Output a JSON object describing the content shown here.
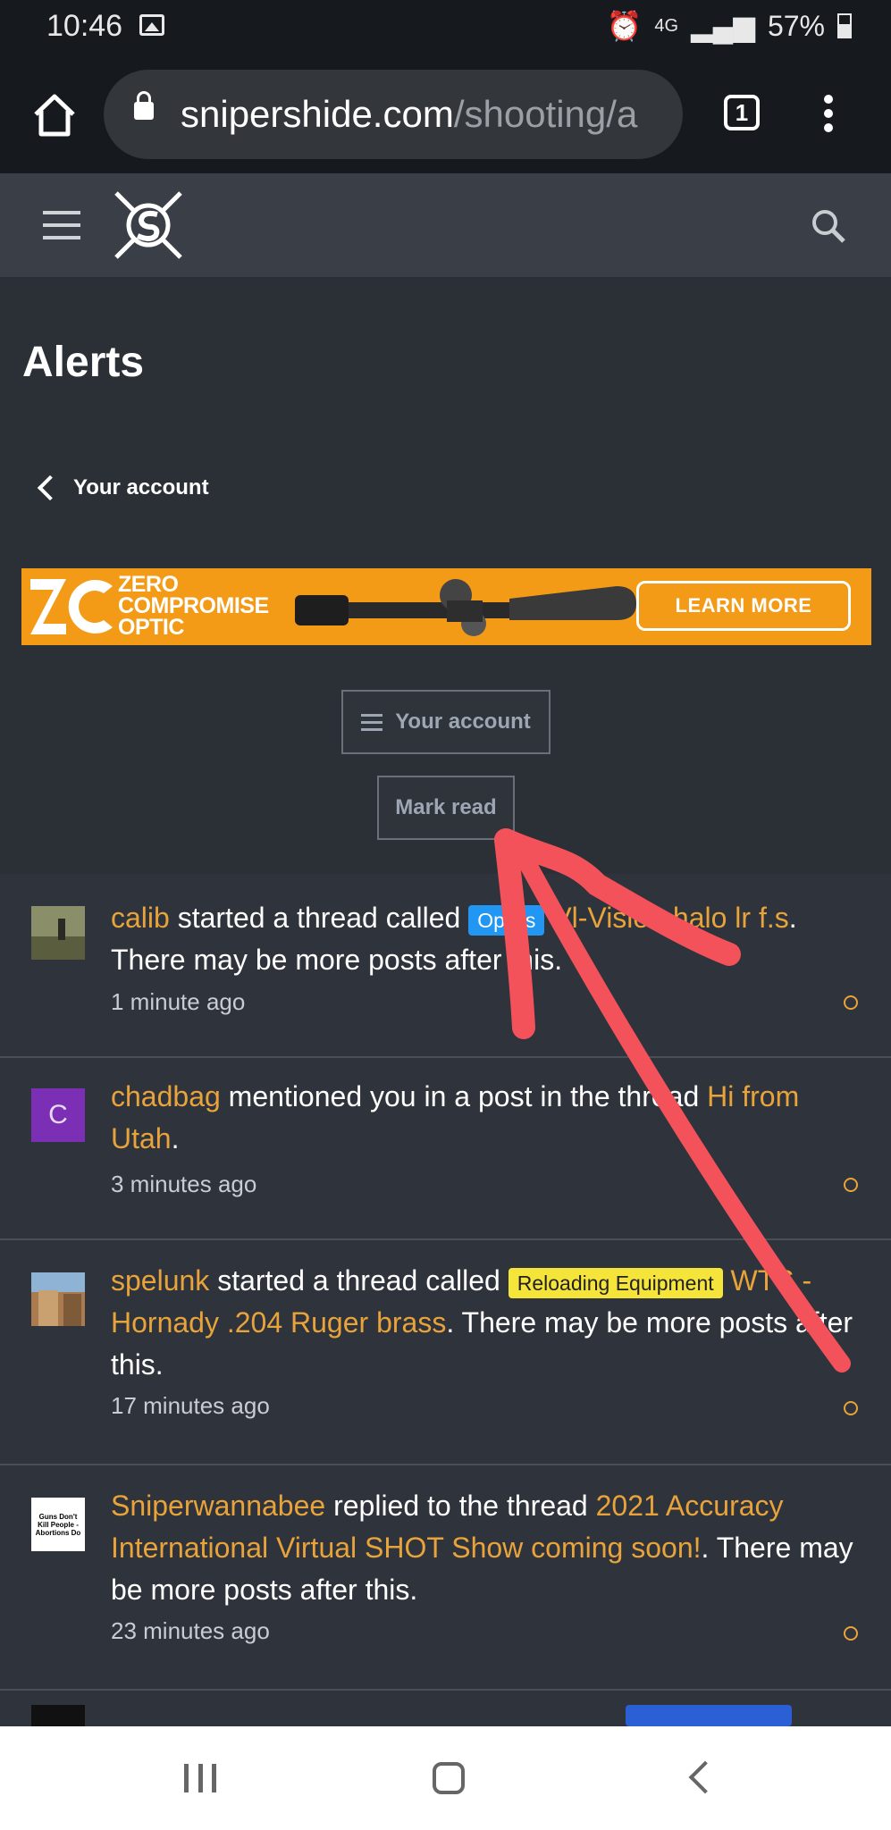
{
  "status_bar": {
    "time": "10:46",
    "network": "4G",
    "battery": "57%"
  },
  "browser": {
    "url_domain": "snipershide.com",
    "url_path": "/shooting/a",
    "tab_count": "1"
  },
  "page": {
    "title": "Alerts",
    "breadcrumb": "Your account",
    "ad": {
      "brand_line1": "ZERO",
      "brand_line2": "COMPROMISE",
      "brand_line3": "OPTIC",
      "cta": "LEARN MORE",
      "color": "#f39a16"
    },
    "account_button": "Your account",
    "mark_read_button": "Mark read"
  },
  "alerts": [
    {
      "user": "calib",
      "action": " started a thread called ",
      "tag": "Optics",
      "thread": "Vl-Vision halo lr f.s",
      "suffix": ". There may be more posts after this.",
      "time": "1 minute ago"
    },
    {
      "avatar_letter": "C",
      "user": "chadbag",
      "action": " mentioned you in a post in the thread ",
      "thread": "Hi from Utah",
      "suffix": ".",
      "time": "3 minutes ago"
    },
    {
      "user": "spelunk",
      "action": " started a thread called ",
      "tag": "Reloading Equipment",
      "thread": "WTS - Hornady .204 Ruger brass",
      "suffix": ". There may be more posts after this.",
      "time": "17 minutes ago"
    },
    {
      "avatar_text": "Guns Don't Kill People - Abortions Do",
      "user": "Sniperwannabee",
      "action": " replied to the thread ",
      "thread": "2021 Accuracy International Virtual SHOT Show coming soon!",
      "suffix": ". There may be more posts after this.",
      "time": "23 minutes ago"
    }
  ],
  "colors": {
    "accent": "#e8a33a",
    "annotation_arrow": "#f4525a"
  }
}
